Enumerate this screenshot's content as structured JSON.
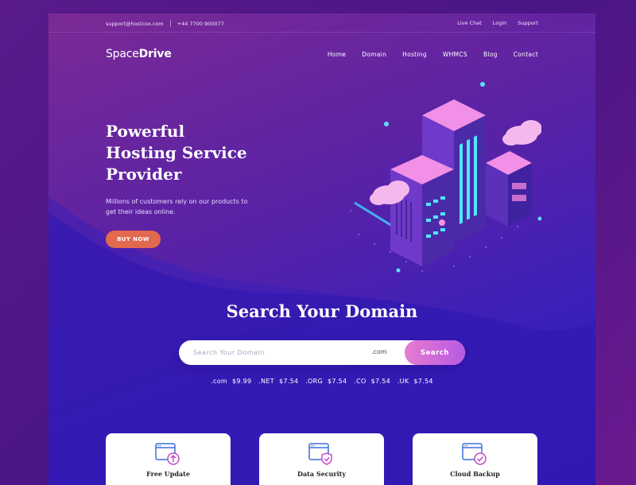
{
  "topbar": {
    "email": "support@hostcox.com",
    "phone": "+44 7700 900077",
    "links": [
      "Live Chat",
      "Login",
      "Support"
    ]
  },
  "brand": {
    "light": "Space",
    "bold": "Drive"
  },
  "nav": [
    "Home",
    "Domain",
    "Hosting",
    "WHMCS",
    "Blog",
    "Contact"
  ],
  "hero": {
    "title_lines": [
      "Powerful",
      "Hosting Service",
      "Provider"
    ],
    "subtitle": "Millions of customers rely on our products to get their ideas online.",
    "cta": "BUY NOW"
  },
  "search": {
    "title": "Search Your Domain",
    "placeholder": "Search Your Domain",
    "tld": ".com",
    "button": "Search"
  },
  "prices": [
    ".com",
    "$9.99",
    ".NET",
    "$7.54",
    ".ORG",
    "$7.54",
    ".CO",
    "$7.54",
    ".UK",
    "$7.54"
  ],
  "features": [
    {
      "label": "Free Update",
      "icon": "browser-upload-icon"
    },
    {
      "label": "Data Security",
      "icon": "browser-shield-icon"
    },
    {
      "label": "Cloud Backup",
      "icon": "browser-check-icon"
    }
  ],
  "colors": {
    "accent": "#e2684e",
    "search_button": "#c766dc",
    "icon_blue": "#3f6fd8",
    "icon_pink": "#c24dc7"
  }
}
